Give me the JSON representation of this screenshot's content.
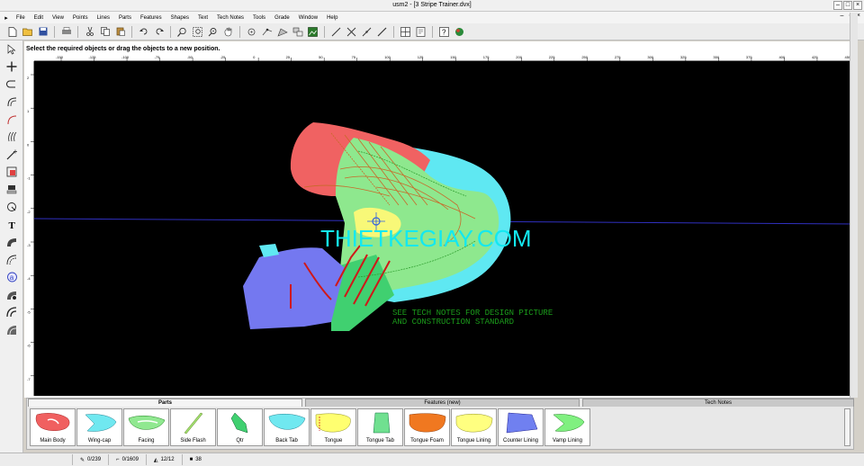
{
  "window": {
    "title": "usm2 - [3 Stripe Trainer.dvx]"
  },
  "menu": [
    "File",
    "Edit",
    "View",
    "Points",
    "Lines",
    "Parts",
    "Features",
    "Shapes",
    "Text",
    "Tech Notes",
    "Tools",
    "Grade",
    "Window",
    "Help"
  ],
  "status_message": "Select the required objects or drag the objects to a new position.",
  "ruler": {
    "h_labels": [
      "-150",
      "-125",
      "-100",
      "-75",
      "-50",
      "-25",
      "0",
      "25",
      "50",
      "75",
      "100",
      "125",
      "150",
      "175",
      "200",
      "225",
      "250",
      "275",
      "300",
      "325",
      "350",
      "375",
      "400",
      "425",
      "450"
    ],
    "v_labels": [
      "2",
      "1",
      "0",
      "-1",
      "-2",
      "-3",
      "-4",
      "-5",
      "-6",
      "-7"
    ]
  },
  "canvas": {
    "watermark": "THIETKEGIAY.COM",
    "tech_note_line1": "SEE TECH NOTES FOR DESIGN PICTURE",
    "tech_note_line2": "AND CONSTRUCTION STANDARD"
  },
  "bottom_tabs": [
    "Parts",
    "Features (new)",
    "Tech Notes"
  ],
  "parts": [
    {
      "label": "Main Body",
      "color": "#f06060"
    },
    {
      "label": "Wing-cap",
      "color": "#70e8f0"
    },
    {
      "label": "Facing",
      "color": "#90e890"
    },
    {
      "label": "Side Flash",
      "color": "#a0e070"
    },
    {
      "label": "Qtr",
      "color": "#40d070"
    },
    {
      "label": "Back Tab",
      "color": "#70e8f0"
    },
    {
      "label": "Tongue",
      "color": "#ffff70"
    },
    {
      "label": "Tongue Tab",
      "color": "#70e090"
    },
    {
      "label": "Tongue Foam",
      "color": "#f07820"
    },
    {
      "label": "Tongue Lining",
      "color": "#ffff80"
    },
    {
      "label": "Counter Lining",
      "color": "#7080f0"
    },
    {
      "label": "Vamp Lining",
      "color": "#80f080"
    }
  ],
  "statusbar": {
    "lines": "0/239",
    "points": "0/1609",
    "parts": "12/12",
    "other": "38"
  }
}
